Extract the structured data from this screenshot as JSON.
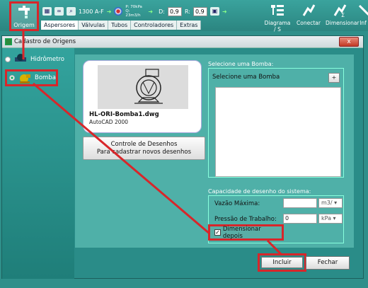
{
  "ribbon": {
    "origem_label": "Origem",
    "sprinkler_label": "1300 A-F",
    "pressure_label": "P: 70kPa",
    "flow_label": "Q: 23m3/h",
    "d_label": "D:",
    "d_value": "0,9",
    "r_label": "R:",
    "r_value": "0,9",
    "tabs": [
      "Aspersores",
      "Válvulas",
      "Tubos",
      "Controladores",
      "Extras"
    ],
    "right_tools": [
      "Diagrama / S",
      "Conectar",
      "Dimensionar",
      "Inf"
    ]
  },
  "dialog": {
    "title": "Cadastro de Origens",
    "close_label": "x",
    "list_items": [
      "Hidrômetro",
      "Bomba"
    ],
    "card": {
      "filename": "HL-ORI-Bomba1.dwg",
      "version": "AutoCAD 2000"
    },
    "controle_line1": "Controle de Desenhos",
    "controle_line2": "Para cadastrar novos desenhos",
    "select_group_title": "Selecione uma Bomba:",
    "select_label": "Selecione uma Bomba",
    "plus_label": "+",
    "capacity_group_title": "Capacidade de desenho do sistema:",
    "vazao_label": "Vazão Máxima:",
    "vazao_value": "",
    "vazao_unit": "m3/",
    "pressao_label": "Pressão de Trabalho:",
    "pressao_value": "0",
    "pressao_unit": "kPa",
    "dimensionar_label": "Dimensionar depois",
    "dimensionar_checked": "✓",
    "incluir_label": "Incluir",
    "fechar_label": "Fechar"
  },
  "colors": {
    "accent_red": "#d8262a",
    "dialog_teal": "#2a8c88",
    "content_teal": "#4fb0a8"
  }
}
